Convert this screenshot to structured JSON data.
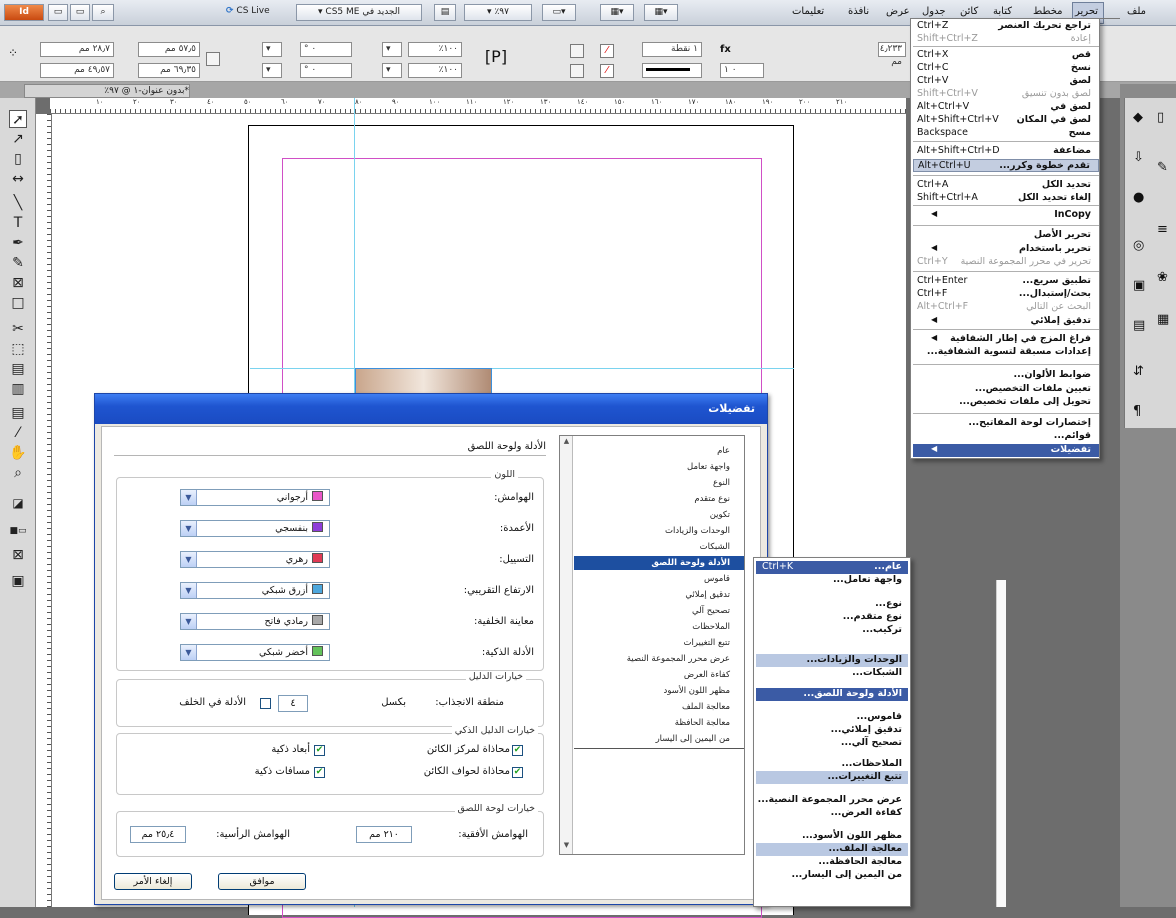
{
  "topbar": {
    "cslive": "CS Live",
    "workspace": "الجديد في CS5 ME",
    "zoom": "٩٧٪",
    "menus": [
      "ملف",
      "تحرير",
      "مخطط",
      "كتابة",
      "كائن",
      "جدول",
      "عرض",
      "نافذة",
      "تعليمات"
    ]
  },
  "control": {
    "w": "٥٧٫٥ مم",
    "h": "٦٩٫٣٥ مم",
    "x": "٤٩٫٥٧ مم",
    "y": "٢٨٫٧ مم",
    "pct1": "١٠٠٪",
    "pct2": "١٠٠٪",
    "pt": "١ نقطة",
    "fx_field": "٤٫٢٣٣ مم",
    "val": "٠ ١"
  },
  "doc_tab": "*بدون عنوان-١ @ ٩٧٪",
  "ruler_ticks": [
    "١٠",
    "٢٠",
    "٣٠",
    "٤٠",
    "٥٠",
    "٦٠",
    "٧٠",
    "٨٠",
    "٩٠",
    "١٠٠",
    "١١٠",
    "١٢٠",
    "١٣٠",
    "١٤٠",
    "١٥٠",
    "١٦٠",
    "١٧٠",
    "١٨٠",
    "١٩٠",
    "٢٠٠",
    "٢١٠"
  ],
  "edit_menu": {
    "items": [
      {
        "label": "تراجع تحريك العنصر",
        "shortcut": "Ctrl+Z",
        "state": "normal"
      },
      {
        "label": "إعادة",
        "shortcut": "Shift+Ctrl+Z",
        "state": "disabled"
      },
      {
        "label": "قص",
        "shortcut": "Ctrl+X",
        "state": "normal"
      },
      {
        "label": "نسخ",
        "shortcut": "Ctrl+C",
        "state": "normal"
      },
      {
        "label": "لصق",
        "shortcut": "Ctrl+V",
        "state": "normal"
      },
      {
        "label": "لصق بدون تنسيق",
        "shortcut": "Shift+Ctrl+V",
        "state": "disabled"
      },
      {
        "label": "لصق في",
        "shortcut": "Alt+Ctrl+V",
        "state": "normal"
      },
      {
        "label": "لصق في المكان",
        "shortcut": "Alt+Shift+Ctrl+V",
        "state": "normal"
      },
      {
        "label": "مسح",
        "shortcut": "Backspace",
        "state": "normal"
      },
      {
        "label": "مضاعفة",
        "shortcut": "Alt+Shift+Ctrl+D",
        "state": "normal"
      },
      {
        "label": "تقدم خطوة وكرر...",
        "shortcut": "Alt+Ctrl+U",
        "state": "selected"
      },
      {
        "label": "تحديد الكل",
        "shortcut": "Ctrl+A",
        "state": "normal"
      },
      {
        "label": "إلغاء تحديد الكل",
        "shortcut": "Shift+Ctrl+A",
        "state": "normal"
      },
      {
        "label": "InCopy",
        "shortcut": "",
        "state": "submenu"
      },
      {
        "label": "تحرير الأصل",
        "shortcut": "",
        "state": "normal"
      },
      {
        "label": "تحرير باستخدام",
        "shortcut": "",
        "state": "submenu"
      },
      {
        "label": "تحرير في محرر المجموعة النصية",
        "shortcut": "Ctrl+Y",
        "state": "disabled"
      },
      {
        "label": "تطبيق سريع...",
        "shortcut": "Ctrl+Enter",
        "state": "normal"
      },
      {
        "label": "بحث/إستبدال...",
        "shortcut": "Ctrl+F",
        "state": "normal"
      },
      {
        "label": "البحث عن التالي",
        "shortcut": "Alt+Ctrl+F",
        "state": "disabled"
      },
      {
        "label": "تدقيق إملائي",
        "shortcut": "",
        "state": "submenu"
      },
      {
        "label": "فراغ المزج في إطار الشفافية",
        "shortcut": "",
        "state": "submenu"
      },
      {
        "label": "إعدادات مسبقة لتسوية الشفافية...",
        "shortcut": "",
        "state": "normal"
      },
      {
        "label": "ضوابط الألوان...",
        "shortcut": "",
        "state": "normal"
      },
      {
        "label": "تعيين ملفات التخصيص...",
        "shortcut": "",
        "state": "normal"
      },
      {
        "label": "تحويل إلى ملفات تخصيص...",
        "shortcut": "",
        "state": "normal"
      },
      {
        "label": "إختصارات لوحة المفاتيح...",
        "shortcut": "",
        "state": "normal"
      },
      {
        "label": "قوائم...",
        "shortcut": "",
        "state": "normal"
      },
      {
        "label": "تفضيلات",
        "shortcut": "",
        "state": "hot"
      }
    ]
  },
  "sub_menu": {
    "items": [
      {
        "label": "عام...",
        "shortcut": "Ctrl+K",
        "state": "hot"
      },
      {
        "label": "واجهة تعامل...",
        "shortcut": "",
        "state": "normal"
      },
      {
        "label": "نوع...",
        "shortcut": "",
        "state": "normal"
      },
      {
        "label": "نوع متقدم...",
        "shortcut": "",
        "state": "normal"
      },
      {
        "label": "تركيب...",
        "shortcut": "",
        "state": "normal"
      },
      {
        "label": "الوحدات والزيادات...",
        "shortcut": "",
        "state": "band"
      },
      {
        "label": "الشبكات...",
        "shortcut": "",
        "state": "normal"
      },
      {
        "label": "الأدلة ولوحة اللصق...",
        "shortcut": "",
        "state": "hot"
      },
      {
        "label": "قاموس...",
        "shortcut": "",
        "state": "normal"
      },
      {
        "label": "تدقيق إملائي...",
        "shortcut": "",
        "state": "normal"
      },
      {
        "label": "تصحيح آلي...",
        "shortcut": "",
        "state": "normal"
      },
      {
        "label": "الملاحظات...",
        "shortcut": "",
        "state": "normal"
      },
      {
        "label": "تتبع التغييرات...",
        "shortcut": "",
        "state": "band"
      },
      {
        "label": "عرض محرر المجموعة النصية...",
        "shortcut": "",
        "state": "normal"
      },
      {
        "label": "كفاءة العرض...",
        "shortcut": "",
        "state": "normal"
      },
      {
        "label": "مظهر اللون الأسود...",
        "shortcut": "",
        "state": "normal"
      },
      {
        "label": "معالجة الملف...",
        "shortcut": "",
        "state": "band"
      },
      {
        "label": "معالجة الحافظة...",
        "shortcut": "",
        "state": "normal"
      },
      {
        "label": "من اليمين إلى اليسار...",
        "shortcut": "",
        "state": "normal"
      }
    ]
  },
  "dialog": {
    "title": "تفضيلات",
    "section_title": "الأدلة ولوحة اللصق",
    "categories": [
      "عام",
      "واجهة تعامل",
      "النوع",
      "نوع متقدم",
      "تكوين",
      "الوحدات والزيادات",
      "الشبكات",
      "الأدلة ولوحة اللصق",
      "قاموس",
      "تدقيق إملائي",
      "تصحيح آلي",
      "الملاحظات",
      "تتبع التغييرات",
      "عرض محرر المجموعة النصية",
      "كفاءة العرض",
      "مظهر اللون الأسود",
      "معالجة الملف",
      "معالجة الحافظة",
      "من اليمين إلى اليسار"
    ],
    "selected_category_index": 7,
    "color_group": "اللون",
    "colors": [
      {
        "label": "الهوامش:",
        "value": "أرجواني",
        "swatch": "#e957c8"
      },
      {
        "label": "الأعمدة:",
        "value": "بنفسجي",
        "swatch": "#8e3dd9"
      },
      {
        "label": "التسييل:",
        "value": "رهري",
        "swatch": "#e03a55"
      },
      {
        "label": "الارتفاع التقريبي:",
        "value": "أزرق شبكي",
        "swatch": "#4da7dd"
      },
      {
        "label": "معاينة الخلفية:",
        "value": "رمادي فاتح",
        "swatch": "#a8a8a8"
      },
      {
        "label": "الأدلة الذكية:",
        "value": "أخضر شبكي",
        "swatch": "#63c25a"
      }
    ],
    "guide_options": {
      "group": "خيارات الدليل",
      "snap_label": "منطقة الانجذاب:",
      "snap_value": "٤",
      "snap_unit": "بكسل",
      "back_label": "الأدلة في الخلف",
      "back_checked": false
    },
    "smart_options": {
      "group": "خيارات الدليل الذكي",
      "items": [
        {
          "label": "محاذاة لمركز الكائن",
          "checked": true
        },
        {
          "label": "أبعاد ذكية",
          "checked": true
        },
        {
          "label": "محاذاة لحواف الكائن",
          "checked": true
        },
        {
          "label": "مسافات ذكية",
          "checked": true
        }
      ]
    },
    "pasteboard": {
      "group": "خيارات لوحة اللصق",
      "h_label": "الهوامش الأفقية:",
      "h_value": "٢١٠ مم",
      "v_label": "الهوامش الرأسية:",
      "v_value": "٢٥٫٤ مم"
    },
    "ok": "موافق",
    "cancel": "إلغاء الأمر"
  }
}
